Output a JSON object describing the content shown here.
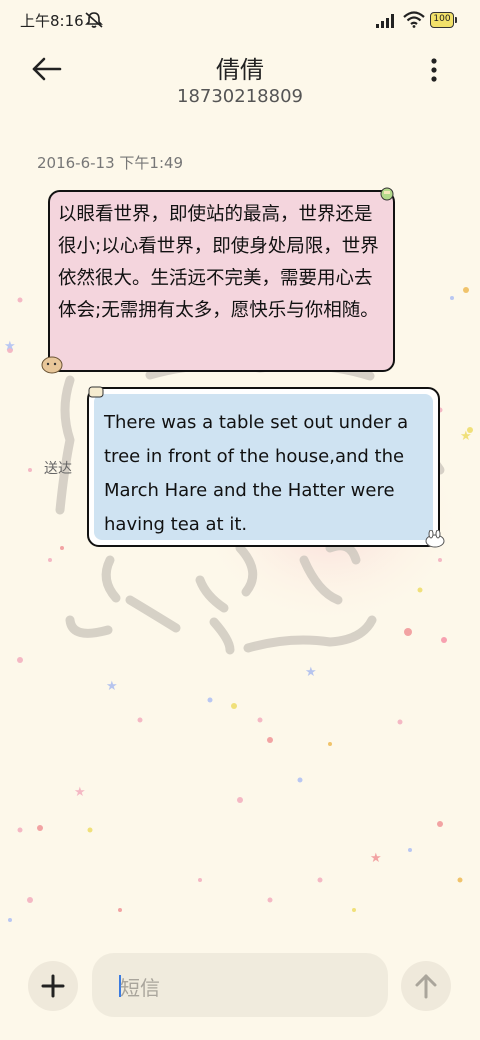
{
  "status_bar": {
    "time": "上午8:16",
    "battery": "100",
    "icons": [
      "mute-icon",
      "signal-icon",
      "wifi-icon",
      "battery-icon"
    ]
  },
  "header": {
    "contact_name": "倩倩",
    "phone_number": "18730218809",
    "icons": [
      "back-arrow-icon",
      "more-options-icon"
    ]
  },
  "conversation": {
    "timestamp": "2016-6-13 下午1:49",
    "messages": [
      {
        "direction": "received",
        "text": "以眼看世界，即使站的最高，世界还是很小;以心看世界，即使身处局限，世界依然很大。生活远不完美，需要用心去体会;无需拥有太多，愿快乐与你相随。"
      },
      {
        "direction": "sent",
        "text": "There was a table set out under a tree in front of the house,and the March Hare and the Hatter were having tea at it.",
        "status": "送达"
      }
    ]
  },
  "composer": {
    "placeholder": "短信",
    "icons": [
      "plus-icon",
      "send-arrow-icon"
    ]
  },
  "colors": {
    "background": "#fdf8ea",
    "received_bubble": "#f4d5dd",
    "sent_bubble": "#cfe3f2",
    "cursor": "#3b7be0"
  }
}
